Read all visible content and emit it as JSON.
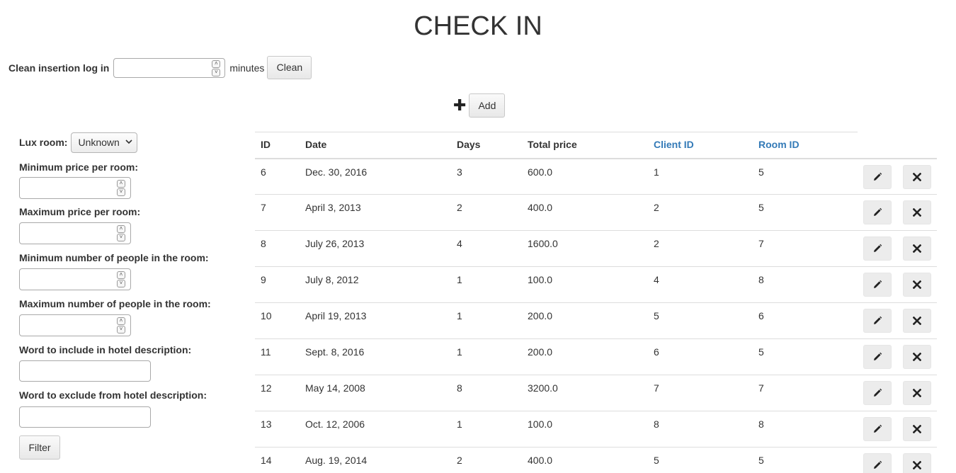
{
  "page": {
    "title": "CHECK IN"
  },
  "clean": {
    "label": "Clean insertion log in",
    "value": "",
    "unit": "minutes",
    "button": "Clean"
  },
  "add": {
    "icon": "plus-icon",
    "button": "Add"
  },
  "filters": {
    "lux_label": "Lux room:",
    "lux_value": "Unknown",
    "min_price_label": "Minimum price per room:",
    "max_price_label": "Maximum price per room:",
    "min_people_label": "Minimum number of people in the room:",
    "max_people_label": "Maximum number of people in the room:",
    "include_label": "Word to include in hotel description:",
    "exclude_label": "Word to exclude from hotel description:",
    "button": "Filter"
  },
  "table": {
    "headers": [
      "ID",
      "Date",
      "Days",
      "Total price",
      "Client ID",
      "Room ID"
    ],
    "rows": [
      {
        "id": "6",
        "date": "Dec. 30, 2016",
        "days": "3",
        "price": "600.0",
        "client": "1",
        "room": "5"
      },
      {
        "id": "7",
        "date": "April 3, 2013",
        "days": "2",
        "price": "400.0",
        "client": "2",
        "room": "5"
      },
      {
        "id": "8",
        "date": "July 26, 2013",
        "days": "4",
        "price": "1600.0",
        "client": "2",
        "room": "7"
      },
      {
        "id": "9",
        "date": "July 8, 2012",
        "days": "1",
        "price": "100.0",
        "client": "4",
        "room": "8"
      },
      {
        "id": "10",
        "date": "April 19, 2013",
        "days": "1",
        "price": "200.0",
        "client": "5",
        "room": "6"
      },
      {
        "id": "11",
        "date": "Sept. 8, 2016",
        "days": "1",
        "price": "200.0",
        "client": "6",
        "room": "5"
      },
      {
        "id": "12",
        "date": "May 14, 2008",
        "days": "8",
        "price": "3200.0",
        "client": "7",
        "room": "7"
      },
      {
        "id": "13",
        "date": "Oct. 12, 2006",
        "days": "1",
        "price": "100.0",
        "client": "8",
        "room": "8"
      },
      {
        "id": "14",
        "date": "Aug. 19, 2014",
        "days": "2",
        "price": "400.0",
        "client": "5",
        "room": "5"
      }
    ],
    "row_actions": [
      "pencil-icon",
      "close-icon"
    ]
  },
  "colors": {
    "link": "#337ab7",
    "border": "#dddddd",
    "text": "#333333"
  }
}
